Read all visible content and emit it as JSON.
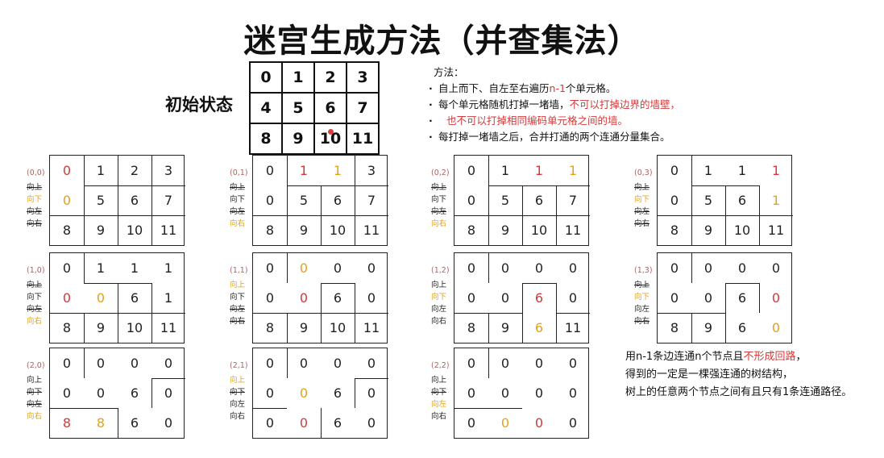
{
  "title": "迷宫生成方法（并查集法）",
  "initial_label": "初始状态",
  "initial_cells": [
    "0",
    "1",
    "2",
    "3",
    "4",
    "5",
    "6",
    "7",
    "8",
    "9",
    "10",
    "11"
  ],
  "method": {
    "heading": "方法：",
    "b1_pre": "自上而下、自左至右遍历",
    "b1_red": "n-1",
    "b1_post": "个单元格。",
    "b2_pre": "每个单元格随机打掉一堵墙，",
    "b2_red1": "不可以打掉边界的墙壁，",
    "b2_red2": "也不可以打掉相同编码单元格之间的墙。",
    "b3": "每打掉一堵墙之后，合并打通的两个连通分量集合。"
  },
  "directions": [
    "向上",
    "向下",
    "向左",
    "向右"
  ],
  "stages": [
    {
      "label": "(0,0)",
      "cells": [
        "0",
        "1",
        "2",
        "3",
        "0",
        "5",
        "6",
        "7",
        "8",
        "9",
        "10",
        "11"
      ],
      "colors": {
        "0": "red",
        "4": "orange"
      },
      "struck": [
        0,
        2,
        3
      ],
      "pick": 1
    },
    {
      "label": "(0,1)",
      "cells": [
        "0",
        "1",
        "1",
        "3",
        "0",
        "5",
        "6",
        "7",
        "8",
        "9",
        "10",
        "11"
      ],
      "colors": {
        "1": "red",
        "2": "orange"
      },
      "struck": [
        0,
        2
      ],
      "pick": 3
    },
    {
      "label": "(0,2)",
      "cells": [
        "0",
        "1",
        "1",
        "1",
        "0",
        "5",
        "6",
        "7",
        "8",
        "9",
        "10",
        "11"
      ],
      "colors": {
        "2": "red",
        "3": "orange"
      },
      "struck": [
        0,
        2
      ],
      "pick": 3
    },
    {
      "label": "(0,3)",
      "cells": [
        "0",
        "1",
        "1",
        "1",
        "0",
        "5",
        "6",
        "1",
        "8",
        "9",
        "10",
        "11"
      ],
      "colors": {
        "3": "red",
        "7": "orange"
      },
      "struck": [
        0,
        2,
        3
      ],
      "pick": 1
    },
    {
      "label": "(1,0)",
      "cells": [
        "0",
        "1",
        "1",
        "1",
        "0",
        "0",
        "6",
        "1",
        "8",
        "9",
        "10",
        "11"
      ],
      "colors": {
        "4": "red",
        "5": "orange"
      },
      "struck": [
        0,
        2
      ],
      "pick": 3
    },
    {
      "label": "(1,1)",
      "cells": [
        "0",
        "0",
        "0",
        "0",
        "0",
        "0",
        "6",
        "0",
        "8",
        "9",
        "10",
        "11"
      ],
      "colors": {
        "5": "red",
        "1": "orange"
      },
      "struck": [
        2,
        3
      ],
      "pick": 0
    },
    {
      "label": "(1,2)",
      "cells": [
        "0",
        "0",
        "0",
        "0",
        "0",
        "0",
        "6",
        "0",
        "8",
        "9",
        "6",
        "11"
      ],
      "colors": {
        "6": "red",
        "10": "orange"
      },
      "struck": [],
      "pick": 1
    },
    {
      "label": "(1,3)",
      "cells": [
        "0",
        "0",
        "0",
        "0",
        "0",
        "0",
        "6",
        "0",
        "8",
        "9",
        "6",
        "0"
      ],
      "colors": {
        "7": "red",
        "11": "orange"
      },
      "struck": [
        0,
        3
      ],
      "pick": 1
    },
    {
      "label": "(2,0)",
      "cells": [
        "0",
        "0",
        "0",
        "0",
        "0",
        "0",
        "6",
        "0",
        "8",
        "8",
        "6",
        "0"
      ],
      "colors": {
        "8": "red",
        "9": "orange"
      },
      "struck": [
        1,
        2
      ],
      "pick": 3
    },
    {
      "label": "(2,1)",
      "cells": [
        "0",
        "0",
        "0",
        "0",
        "0",
        "0",
        "6",
        "0",
        "0",
        "0",
        "6",
        "0"
      ],
      "colors": {
        "9": "red",
        "5": "orange"
      },
      "struck": [
        1
      ],
      "pick": 0
    },
    {
      "label": "(2,2)",
      "cells": [
        "0",
        "0",
        "0",
        "0",
        "0",
        "0",
        "0",
        "0",
        "0",
        "0",
        "0",
        "0"
      ],
      "colors": {
        "10": "red",
        "9": "orange"
      },
      "struck": [
        1
      ],
      "pick": 2
    }
  ],
  "note": {
    "l1_pre": "用n-1条边连通n个节点且",
    "l1_red": "不形成回路",
    "l1_post": "，",
    "l2": "得到的一定是一棵强连通的树结构，",
    "l3": "树上的任意两个节点之间有且只有1条连通路径。"
  }
}
